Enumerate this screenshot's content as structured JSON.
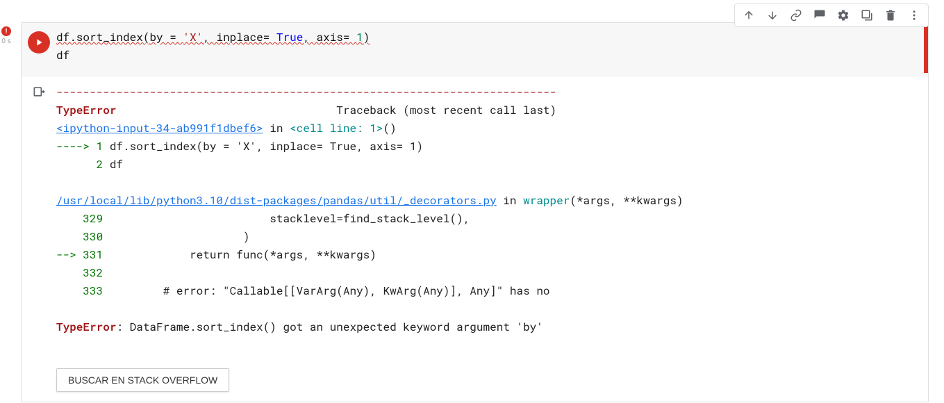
{
  "gutter": {
    "exec_time": "0 s"
  },
  "toolbar": {
    "move_up": "Move cell up",
    "move_down": "Move cell down",
    "link": "Get link to cell",
    "comment": "Add a comment",
    "settings": "Open editor settings",
    "mirror": "Mirror cell in tab",
    "delete": "Delete cell",
    "more": "More cell actions"
  },
  "code": {
    "line1_parts": {
      "p1": "df.sort_index",
      "p2": "(",
      "p3": "by = ",
      "p4": "'X'",
      "p5": ", inplace= ",
      "p6": "True",
      "p7": ", axis= ",
      "p8": "1",
      "p9": ")"
    },
    "line2": "df"
  },
  "traceback": {
    "separator": "---------------------------------------------------------------------------",
    "error_name": "TypeError",
    "header_right": "Traceback (most recent call last)",
    "loc1_link": "<ipython-input-34-ab991f1dbef6>",
    "loc1_in": " in ",
    "loc1_frame": "<cell line: 1>",
    "loc1_tail": "()",
    "arrow1": "----> 1 ",
    "l1_code": "df.sort_index(by = 'X', inplace= True, axis= 1)",
    "l2_num": "      2 ",
    "l2_code": "df",
    "loc2_link": "/usr/local/lib/python3.10/dist-packages/pandas/util/_decorators.py",
    "loc2_in": " in ",
    "loc2_frame": "wrapper",
    "loc2_tail": "(*args, **kwargs)",
    "r329_num": "    329 ",
    "r329_code": "                        stacklevel=find_stack_level(),",
    "r330_num": "    330 ",
    "r330_code": "                    )",
    "r331_arrow": "--> ",
    "r331_num": "331 ",
    "r331_code": "            return func(*args, **kwargs)",
    "r332_num": "    332 ",
    "r332_code": "",
    "r333_num": "    333 ",
    "r333_code": "        # error: \"Callable[[VarArg(Any), KwArg(Any)], Any]\" has no",
    "final_err": "TypeError",
    "final_msg": ": DataFrame.sort_index() got an unexpected keyword argument 'by'"
  },
  "buttons": {
    "stack_overflow": "BUSCAR EN STACK OVERFLOW"
  }
}
